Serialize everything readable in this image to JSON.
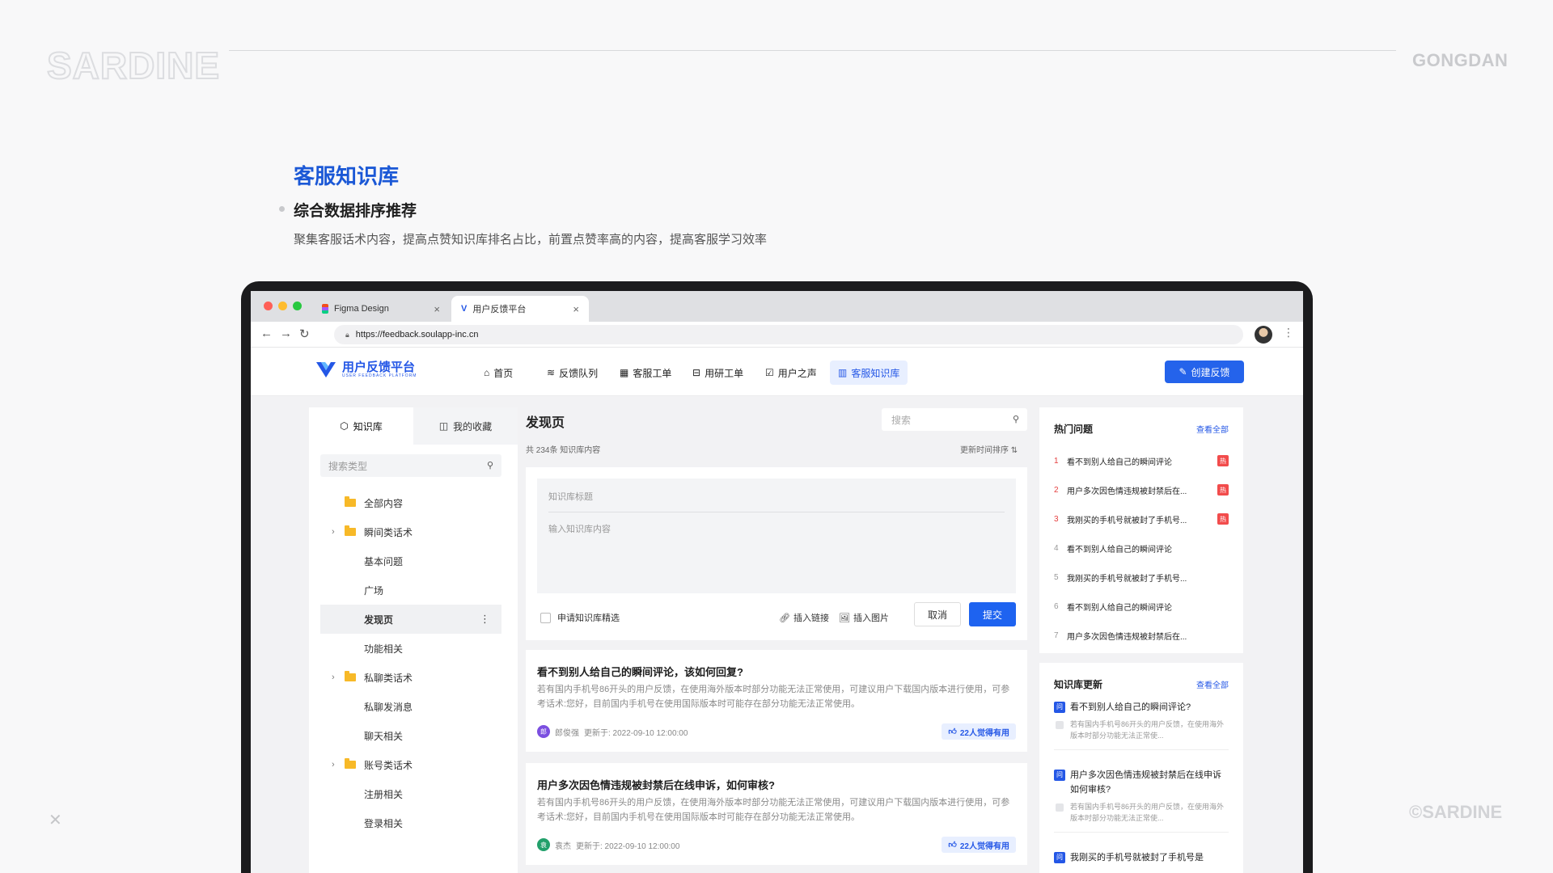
{
  "slide": {
    "brand": "SARDINE",
    "right_tag": "GONGDAN",
    "copyright": "©SARDINE",
    "close_glyph": "✕",
    "section_title": "客服知识库",
    "section_subtitle": "综合数据排序推荐",
    "section_desc": "聚集客服话术内容，提高点赞知识库排名占比，前置点赞率高的内容，提高客服学习效率"
  },
  "browser": {
    "tabs": [
      {
        "label": "Figma Design",
        "icon": "figma-icon"
      },
      {
        "label": "用户反馈平台",
        "icon": "app-logo-icon"
      }
    ],
    "url": "https://feedback.soulapp-inc.cn"
  },
  "app": {
    "logo_text": "用户反馈平台",
    "logo_tag": "USER FEEDBACK PLATFORM",
    "nav": [
      {
        "label": "首页",
        "icon": "⌂"
      },
      {
        "label": "反馈队列",
        "icon": "≋"
      },
      {
        "label": "客服工单",
        "icon": "▦"
      },
      {
        "label": "用研工单",
        "icon": "⊟"
      },
      {
        "label": "用户之声",
        "icon": "☑"
      },
      {
        "label": "客服知识库",
        "icon": "▥"
      }
    ],
    "create_button": "创建反馈"
  },
  "left": {
    "tabs": [
      "知识库",
      "我的收藏"
    ],
    "search_placeholder": "搜索类型",
    "tree": [
      {
        "label": "全部内容",
        "folder": true,
        "chevron": false
      },
      {
        "label": "瞬间类话术",
        "folder": true,
        "chevron": true
      },
      {
        "label": "基本问题",
        "folder": false
      },
      {
        "label": "广场",
        "folder": false
      },
      {
        "label": "发现页",
        "folder": false,
        "selected": true
      },
      {
        "label": "功能相关",
        "folder": false
      },
      {
        "label": "私聊类话术",
        "folder": true,
        "chevron": true
      },
      {
        "label": "私聊发消息",
        "folder": false
      },
      {
        "label": "聊天相关",
        "folder": false
      },
      {
        "label": "账号类话术",
        "folder": true,
        "chevron": true
      },
      {
        "label": "注册相关",
        "folder": false
      },
      {
        "label": "登录相关",
        "folder": false
      }
    ]
  },
  "main": {
    "title": "发现页",
    "search_placeholder": "搜索",
    "count": "共 234条 知识库内容",
    "sort": "更新时间排序",
    "editor": {
      "title_placeholder": "知识库标题",
      "body_placeholder": "输入知识库内容",
      "apply_label": "申请知识库精选",
      "insert_link": "插入链接",
      "insert_image": "插入图片",
      "cancel": "取消",
      "submit": "提交"
    },
    "cards": [
      {
        "title": "看不到别人给自己的瞬间评论，该如何回复?",
        "desc": "若有国内手机号86开头的用户反馈，在使用海外版本时部分功能无法正常使用，可建议用户下载国内版本进行使用，可参考话术:您好，目前国内手机号在使用国际版本时可能存在部分功能无法正常使用。",
        "author": "郎俊强",
        "avatar_char": "郎",
        "avatar_color": "#7b4fe0",
        "updated": "更新于: 2022-09-10 12:00:00",
        "likes": "22人觉得有用"
      },
      {
        "title": "用户多次因色情违规被封禁后在线申诉，如何审核?",
        "desc": "若有国内手机号86开头的用户反馈，在使用海外版本时部分功能无法正常使用，可建议用户下载国内版本进行使用，可参考话术:您好，目前国内手机号在使用国际版本时可能存在部分功能无法正常使用。",
        "author": "袁杰",
        "avatar_char": "袁",
        "avatar_color": "#22a06b",
        "updated": "更新于: 2022-09-10 12:00:00",
        "likes": "22人觉得有用"
      }
    ]
  },
  "right": {
    "hot": {
      "title": "热门问题",
      "view_all": "查看全部",
      "items": [
        {
          "rank": "1",
          "text": "看不到别人给自己的瞬间评论",
          "hot": true
        },
        {
          "rank": "2",
          "text": "用户多次因色情违规被封禁后在...",
          "hot": true
        },
        {
          "rank": "3",
          "text": "我刚买的手机号就被封了手机号...",
          "hot": true
        },
        {
          "rank": "4",
          "text": "看不到别人给自己的瞬间评论",
          "hot": false
        },
        {
          "rank": "5",
          "text": "我刚买的手机号就被封了手机号...",
          "hot": false
        },
        {
          "rank": "6",
          "text": "看不到别人给自己的瞬间评论",
          "hot": false
        },
        {
          "rank": "7",
          "text": "用户多次因色情违规被封禁后在...",
          "hot": false
        }
      ],
      "hot_badge": "热"
    },
    "updates": {
      "title": "知识库更新",
      "view_all": "查看全部",
      "items": [
        {
          "title": "看不到别人给自己的瞬间评论?",
          "desc": "若有国内手机号86开头的用户反馈，在使用海外版本时部分功能无法正常使..."
        },
        {
          "title": "用户多次因色情违规被封禁后在线申诉如何审核?",
          "desc": "若有国内手机号86开头的用户反馈，在使用海外版本时部分功能无法正常使..."
        },
        {
          "title": "我刚买的手机号就被封了手机号是",
          "desc": ""
        }
      ]
    }
  },
  "colors": {
    "accent": "#2457e6",
    "primary_button": "#2463eb",
    "hot_red": "#f24c4c",
    "folder": "#f7b928"
  }
}
